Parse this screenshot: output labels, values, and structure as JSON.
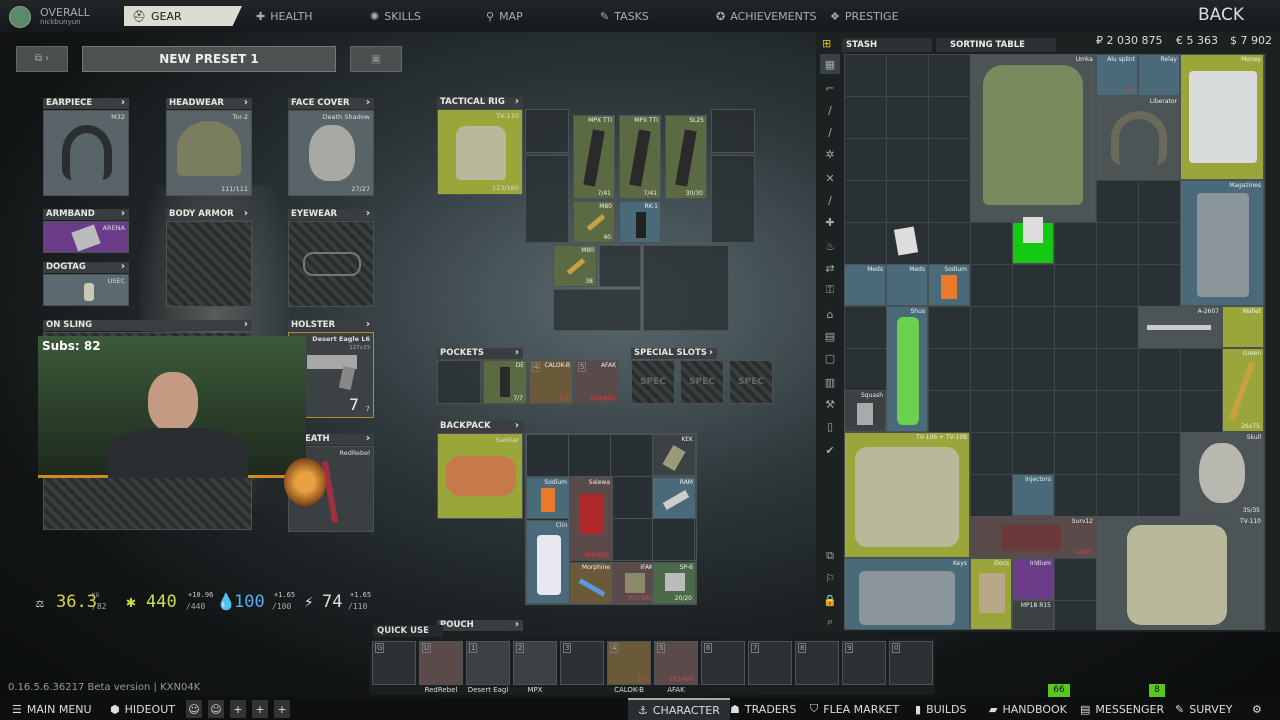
{
  "topnav": {
    "overall": "OVERALL",
    "username": "nickbunyun",
    "tabs": [
      "GEAR",
      "HEALTH",
      "SKILLS",
      "MAP",
      "TASKS",
      "ACHIEVEMENTS",
      "PRESTIGE"
    ],
    "back": "BACK"
  },
  "preset": {
    "name": "NEW PRESET 1"
  },
  "equipment": {
    "earpiece": {
      "label": "EARPIECE",
      "item": "M32"
    },
    "headwear": {
      "label": "HEADWEAR",
      "item": "Tor-2",
      "count": "111/111"
    },
    "face_cover": {
      "label": "FACE COVER",
      "item": "Death Shadow",
      "count": "27/27"
    },
    "armband": {
      "label": "ARMBAND",
      "item": "ARENA"
    },
    "body_armor": {
      "label": "BODY ARMOR"
    },
    "eyewear": {
      "label": "EYEWEAR"
    },
    "dogtag": {
      "label": "DOGTAG",
      "item": "USEC"
    },
    "on_sling": {
      "label": "ON SLING"
    },
    "holster": {
      "label": "HOLSTER",
      "item": "Desert Eagle L6",
      "sub": "127x33",
      "ammo": "7",
      "ammo_max": "7"
    },
    "sheath": {
      "label": "EATH",
      "item": "RedRebel"
    }
  },
  "stream": {
    "subs": "Subs: 82"
  },
  "stats": {
    "weight": "36.3",
    "weight_unit": "KG",
    "weight_max": "/82",
    "energy": "440",
    "energy_max": "/440",
    "energy_delta": "+10.96",
    "hydration": "100",
    "hydration_max": "/100",
    "hydration_delta": "+1.65",
    "stamina": "74",
    "stamina_max": "/110",
    "stamina_delta": "+1.65"
  },
  "rig": {
    "label": "TACTICAL RIG",
    "item": "TV-110",
    "count": "123/160",
    "cells": [
      {
        "name": "MPX TTI",
        "count": "7/41"
      },
      {
        "name": "MPX TTI",
        "count": "7/41"
      },
      {
        "name": "SL25",
        "count": "30/30"
      },
      {
        "name": "M80",
        "count": "40"
      },
      {
        "name": "RK-1",
        "count": ""
      },
      {
        "name": "M80",
        "count": "38"
      }
    ]
  },
  "pockets": {
    "label": "POCKETS",
    "items": [
      {
        "name": "DE",
        "count": "7/7"
      },
      {
        "name": "CALOK-B",
        "count": "1/3",
        "key": "4"
      },
      {
        "name": "AFAK",
        "count": "253/400",
        "key": "5"
      }
    ]
  },
  "special": {
    "label": "SPECIAL SLOTS",
    "items": [
      "SPEC",
      "SPEC",
      "SPEC"
    ]
  },
  "backpack": {
    "label": "BACKPACK",
    "item": "Sanitar",
    "items": [
      {
        "name": "KEK"
      },
      {
        "name": "RAM"
      },
      {
        "name": "Sodium"
      },
      {
        "name": "Salewa",
        "count": "400/400"
      },
      {
        "name": "Clin"
      },
      {
        "name": "Morphine"
      },
      {
        "name": "IFAK",
        "count": "300/300"
      },
      {
        "name": "SP-6",
        "count": "20/20"
      }
    ]
  },
  "pouch": {
    "label": "POUCH"
  },
  "quickuse": {
    "label": "QUICK USE",
    "slots": [
      {
        "key": "G",
        "item": ""
      },
      {
        "key": "U",
        "item": "RedRebel"
      },
      {
        "key": "1",
        "item": "Desert Eagl"
      },
      {
        "key": "2",
        "item": "MPX"
      },
      {
        "key": "3",
        "item": ""
      },
      {
        "key": "4",
        "item": "CALOK-B",
        "count": "1/3"
      },
      {
        "key": "5",
        "item": "AFAK",
        "count": "253/400"
      },
      {
        "key": "6",
        "item": ""
      },
      {
        "key": "7",
        "item": ""
      },
      {
        "key": "8",
        "item": ""
      },
      {
        "key": "9",
        "item": ""
      },
      {
        "key": "0",
        "item": ""
      }
    ]
  },
  "stash": {
    "tab1": "STASH",
    "tab2": "SORTING TABLE",
    "roubles": "₽ 2 030 875",
    "euros": "€ 5 363",
    "dollars": "$ 7 902",
    "items": [
      {
        "name": "Umka"
      },
      {
        "name": "Alu splint",
        "count": "5/5"
      },
      {
        "name": "Relay"
      },
      {
        "name": "Money"
      },
      {
        "name": "Liberator"
      },
      {
        "name": "Magazines"
      },
      {
        "name": "Meds"
      },
      {
        "name": "Meds"
      },
      {
        "name": "Sodium"
      },
      {
        "name": "Shus"
      },
      {
        "name": "A-2607"
      },
      {
        "name": "Wallet"
      },
      {
        "name": "Green"
      },
      {
        "name": "Squash"
      },
      {
        "name": "TV-106 + TV-109"
      },
      {
        "name": "Injectors"
      },
      {
        "name": "Surv12",
        "count": "14/15"
      },
      {
        "name": "Skull",
        "count": "35/35"
      },
      {
        "name": "TV-110"
      },
      {
        "name": "Keys"
      },
      {
        "name": "Docs"
      },
      {
        "name": "Iridium"
      },
      {
        "name": "MP18 R15"
      },
      {
        "name": "",
        "count": "26x75"
      }
    ]
  },
  "version": "0.16.5.6.36217 Beta version | KXN04K",
  "notifications": {
    "flea": "66",
    "messenger": "8"
  },
  "bottomnav": {
    "main_menu": "MAIN MENU",
    "hideout": "HIDEOUT",
    "character": "CHARACTER",
    "traders": "TRADERS",
    "flea": "FLEA MARKET",
    "builds": "BUILDS",
    "handbook": "HANDBOOK",
    "messenger": "MESSENGER",
    "survey": "SURVEY"
  },
  "colors": {
    "accent_yellow": "#9aa63a",
    "energy": "#c8e048",
    "hydration": "#5aaaf0",
    "weight": "#d8d840",
    "green_item": "#14c814"
  }
}
